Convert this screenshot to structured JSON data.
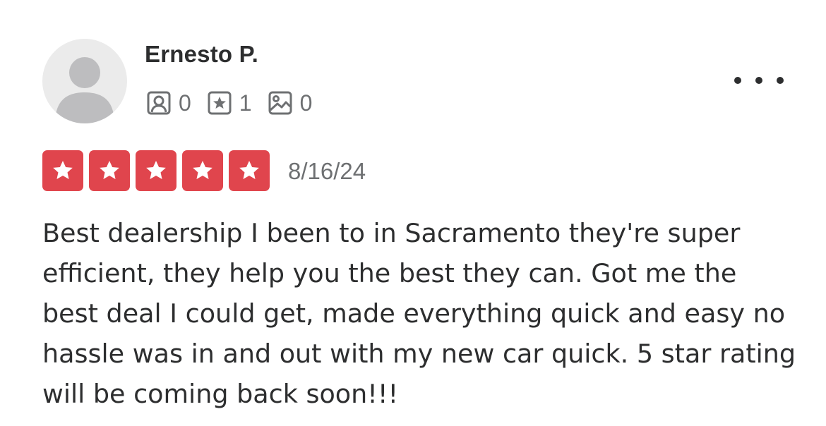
{
  "reviewer": {
    "name": "Ernesto P.",
    "avatar_icon": "default-avatar-icon",
    "stats": [
      {
        "icon": "friends-icon",
        "count": "0"
      },
      {
        "icon": "reviews-icon",
        "count": "1"
      },
      {
        "icon": "photos-icon",
        "count": "0"
      }
    ]
  },
  "menu": {
    "icon": "more-options-icon"
  },
  "review": {
    "rating": 5,
    "rating_max": 5,
    "date": "8/16/24",
    "text": "Best dealership I been to in Sacramento they're super efficient, they help you the best they can. Got me the best deal I could get, made everything quick and easy no hassle was in and out with my new car quick. 5 star rating will be coming back soon!!!"
  },
  "colors": {
    "star_fill": "#e0454d",
    "text_primary": "#2d2e2f",
    "text_secondary": "#6e7072",
    "avatar_bg": "#ebebeb",
    "avatar_figure": "#bdbdbf"
  }
}
